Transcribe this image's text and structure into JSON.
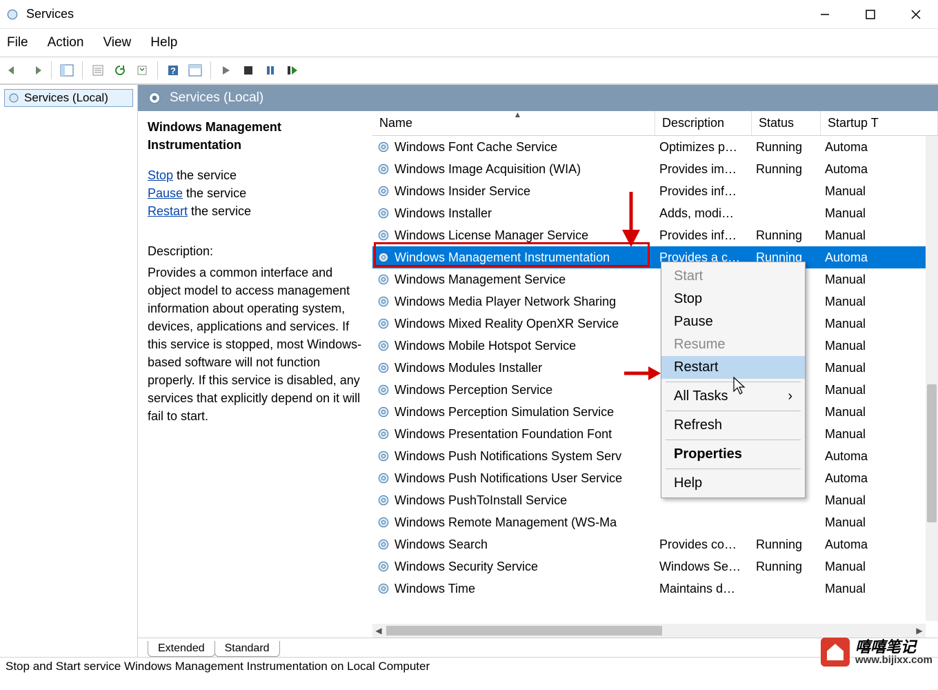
{
  "window": {
    "title": "Services"
  },
  "menu": {
    "file": "File",
    "action": "Action",
    "view": "View",
    "help": "Help"
  },
  "tree": {
    "root": "Services (Local)"
  },
  "content_header": "Services (Local)",
  "detail": {
    "title": "Windows Management Instrumentation",
    "stop_link": "Stop",
    "stop_suffix": " the service",
    "pause_link": "Pause",
    "pause_suffix": " the service",
    "restart_link": "Restart",
    "restart_suffix": " the service",
    "desc_label": "Description:",
    "desc_text": "Provides a common interface and object model to access management information about operating system, devices, applications and services. If this service is stopped, most Windows-based software will not function properly. If this service is disabled, any services that explicitly depend on it will fail to start."
  },
  "columns": {
    "name": "Name",
    "description": "Description",
    "status": "Status",
    "startup": "Startup T"
  },
  "services": [
    {
      "name": "Windows Font Cache Service",
      "desc": "Optimizes p…",
      "status": "Running",
      "startup": "Automa"
    },
    {
      "name": "Windows Image Acquisition (WIA)",
      "desc": "Provides im…",
      "status": "Running",
      "startup": "Automa"
    },
    {
      "name": "Windows Insider Service",
      "desc": "Provides inf…",
      "status": "",
      "startup": "Manual"
    },
    {
      "name": "Windows Installer",
      "desc": "Adds, modi…",
      "status": "",
      "startup": "Manual"
    },
    {
      "name": "Windows License Manager Service",
      "desc": "Provides inf…",
      "status": "Running",
      "startup": "Manual"
    },
    {
      "name": "Windows Management Instrumentation",
      "desc": "Provides a c…",
      "status": "Running",
      "startup": "Automa",
      "selected": true
    },
    {
      "name": "Windows Management Service",
      "desc": "",
      "status": "",
      "startup": "Manual"
    },
    {
      "name": "Windows Media Player Network Sharing",
      "desc": "",
      "status": "",
      "startup": "Manual"
    },
    {
      "name": "Windows Mixed Reality OpenXR Service",
      "desc": "",
      "status": "",
      "startup": "Manual"
    },
    {
      "name": "Windows Mobile Hotspot Service",
      "desc": "",
      "status": "",
      "startup": "Manual"
    },
    {
      "name": "Windows Modules Installer",
      "desc": "",
      "status": "",
      "startup": "Manual"
    },
    {
      "name": "Windows Perception Service",
      "desc": "",
      "status": "",
      "startup": "Manual"
    },
    {
      "name": "Windows Perception Simulation Service",
      "desc": "",
      "status": "",
      "startup": "Manual"
    },
    {
      "name": "Windows Presentation Foundation Font",
      "desc": "",
      "status": "",
      "startup": "Manual"
    },
    {
      "name": "Windows Push Notifications System Serv",
      "desc": "",
      "status": "",
      "startup": "Automa"
    },
    {
      "name": "Windows Push Notifications User Service",
      "desc": "",
      "status": "",
      "startup": "Automa"
    },
    {
      "name": "Windows PushToInstall Service",
      "desc": "",
      "status": "",
      "startup": "Manual"
    },
    {
      "name": "Windows Remote Management (WS-Ma",
      "desc": "",
      "status": "",
      "startup": "Manual"
    },
    {
      "name": "Windows Search",
      "desc": "Provides co…",
      "status": "Running",
      "startup": "Automa"
    },
    {
      "name": "Windows Security Service",
      "desc": "Windows Se…",
      "status": "Running",
      "startup": "Manual"
    },
    {
      "name": "Windows Time",
      "desc": "Maintains d…",
      "status": "",
      "startup": "Manual"
    }
  ],
  "context_menu": {
    "start": "Start",
    "stop": "Stop",
    "pause": "Pause",
    "resume": "Resume",
    "restart": "Restart",
    "all_tasks": "All Tasks",
    "refresh": "Refresh",
    "properties": "Properties",
    "help": "Help"
  },
  "tabs": {
    "extended": "Extended",
    "standard": "Standard"
  },
  "statusbar": "Stop and Start service Windows Management Instrumentation on Local Computer",
  "watermark": {
    "cn": "嘻嘻笔记",
    "url": "www.bijixx.com"
  }
}
